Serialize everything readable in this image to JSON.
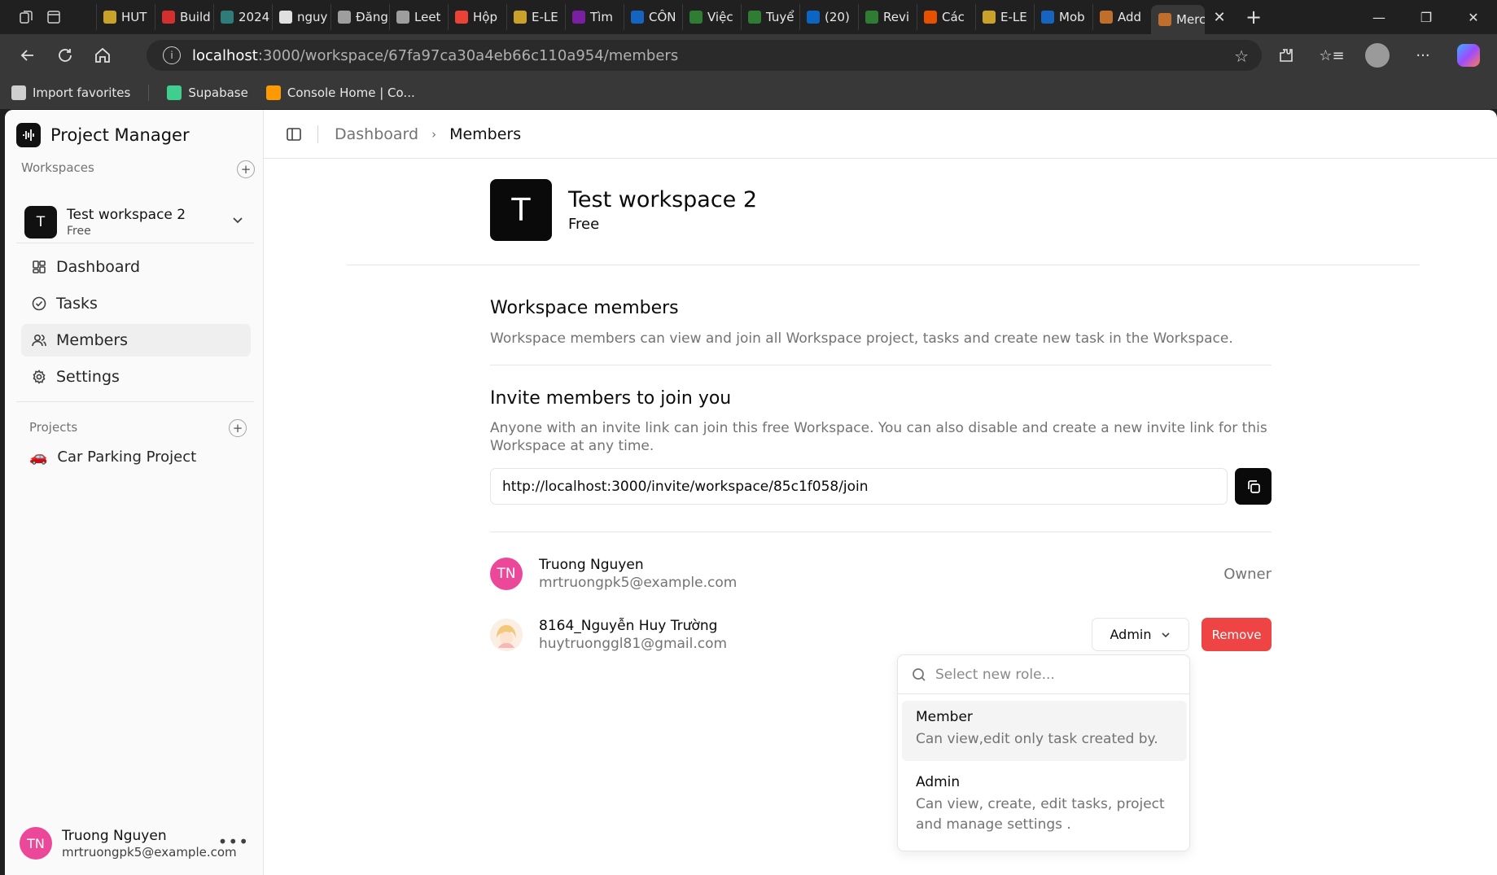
{
  "browser": {
    "tabs": [
      {
        "label": "HUT",
        "color": "#c9a227"
      },
      {
        "label": "Build",
        "color": "#d32f2f"
      },
      {
        "label": "2024",
        "color": "#2e7d7a"
      },
      {
        "label": "nguy",
        "color": "#e0e0e0"
      },
      {
        "label": "Đăng",
        "color": "#9e9e9e"
      },
      {
        "label": "Leet",
        "color": "#9e9e9e"
      },
      {
        "label": "Hộp",
        "color": "#ea4335"
      },
      {
        "label": "E-LE",
        "color": "#c9a227"
      },
      {
        "label": "Tìm",
        "color": "#7b1fa2"
      },
      {
        "label": "CÔN",
        "color": "#1565c0"
      },
      {
        "label": "Việc",
        "color": "#2e7d32"
      },
      {
        "label": "Tuyể",
        "color": "#2e7d32"
      },
      {
        "label": "(20)",
        "color": "#0a66c2"
      },
      {
        "label": "Revi",
        "color": "#2e7d32"
      },
      {
        "label": "Các",
        "color": "#e65100"
      },
      {
        "label": "E-LE",
        "color": "#c9a227"
      },
      {
        "label": "Mob",
        "color": "#1565c0"
      },
      {
        "label": "Add",
        "color": "#bf6e2b"
      },
      {
        "label": "Merc",
        "color": "#bf6e2b"
      }
    ],
    "url_host": "localhost",
    "url_path": ":3000/workspace/67fa97ca30a4eb66c110a954/members",
    "bookmarks": [
      {
        "label": "Import favorites",
        "color": "#cfcfcf"
      },
      {
        "label": "Supabase",
        "color": "#3ecf8e"
      },
      {
        "label": "Console Home | Co...",
        "color": "#ff9900"
      }
    ]
  },
  "sidebar": {
    "brand": "Project Manager",
    "workspaces_label": "Workspaces",
    "workspace": {
      "initial": "T",
      "name": "Test workspace 2",
      "plan": "Free"
    },
    "nav": [
      {
        "label": "Dashboard",
        "icon": "dashboard-icon"
      },
      {
        "label": "Tasks",
        "icon": "tasks-icon"
      },
      {
        "label": "Members",
        "icon": "members-icon",
        "active": true
      },
      {
        "label": "Settings",
        "icon": "settings-icon"
      }
    ],
    "projects_label": "Projects",
    "projects": [
      {
        "emoji": "🚗",
        "name": "Car Parking Project"
      }
    ],
    "user": {
      "initials": "TN",
      "name": "Truong Nguyen",
      "email": "mrtruongpk5@example.com"
    }
  },
  "breadcrumb": {
    "parent": "Dashboard",
    "current": "Members"
  },
  "workspace_header": {
    "initial": "T",
    "name": "Test workspace 2",
    "plan": "Free"
  },
  "members_section": {
    "title": "Workspace members",
    "description": "Workspace members can view and join all Workspace project, tasks and create new task in the Workspace."
  },
  "invite_section": {
    "title": "Invite members to join you",
    "description_line1": "Anyone with an invite link can join this free Workspace. You can also disable and create a new invite link for this",
    "description_line2": "Workspace at any time.",
    "link": "http://localhost:3000/invite/workspace/85c1f058/join"
  },
  "members": [
    {
      "initials": "TN",
      "name": "Truong Nguyen",
      "email": "mrtruongpk5@example.com",
      "role": "Owner",
      "avatar_color": "#ec4899"
    },
    {
      "initials": "",
      "name": "8164_Nguyễn Huy Trường",
      "email": "huytruonggl81@gmail.com",
      "role": "Admin",
      "remove_label": "Remove"
    }
  ],
  "role_dropdown": {
    "placeholder": "Select new role...",
    "options": [
      {
        "title": "Member",
        "desc": "Can view,edit only task created by."
      },
      {
        "title": "Admin",
        "desc_line1": "Can view, create, edit tasks, project",
        "desc_line2": "and manage settings ."
      }
    ]
  }
}
